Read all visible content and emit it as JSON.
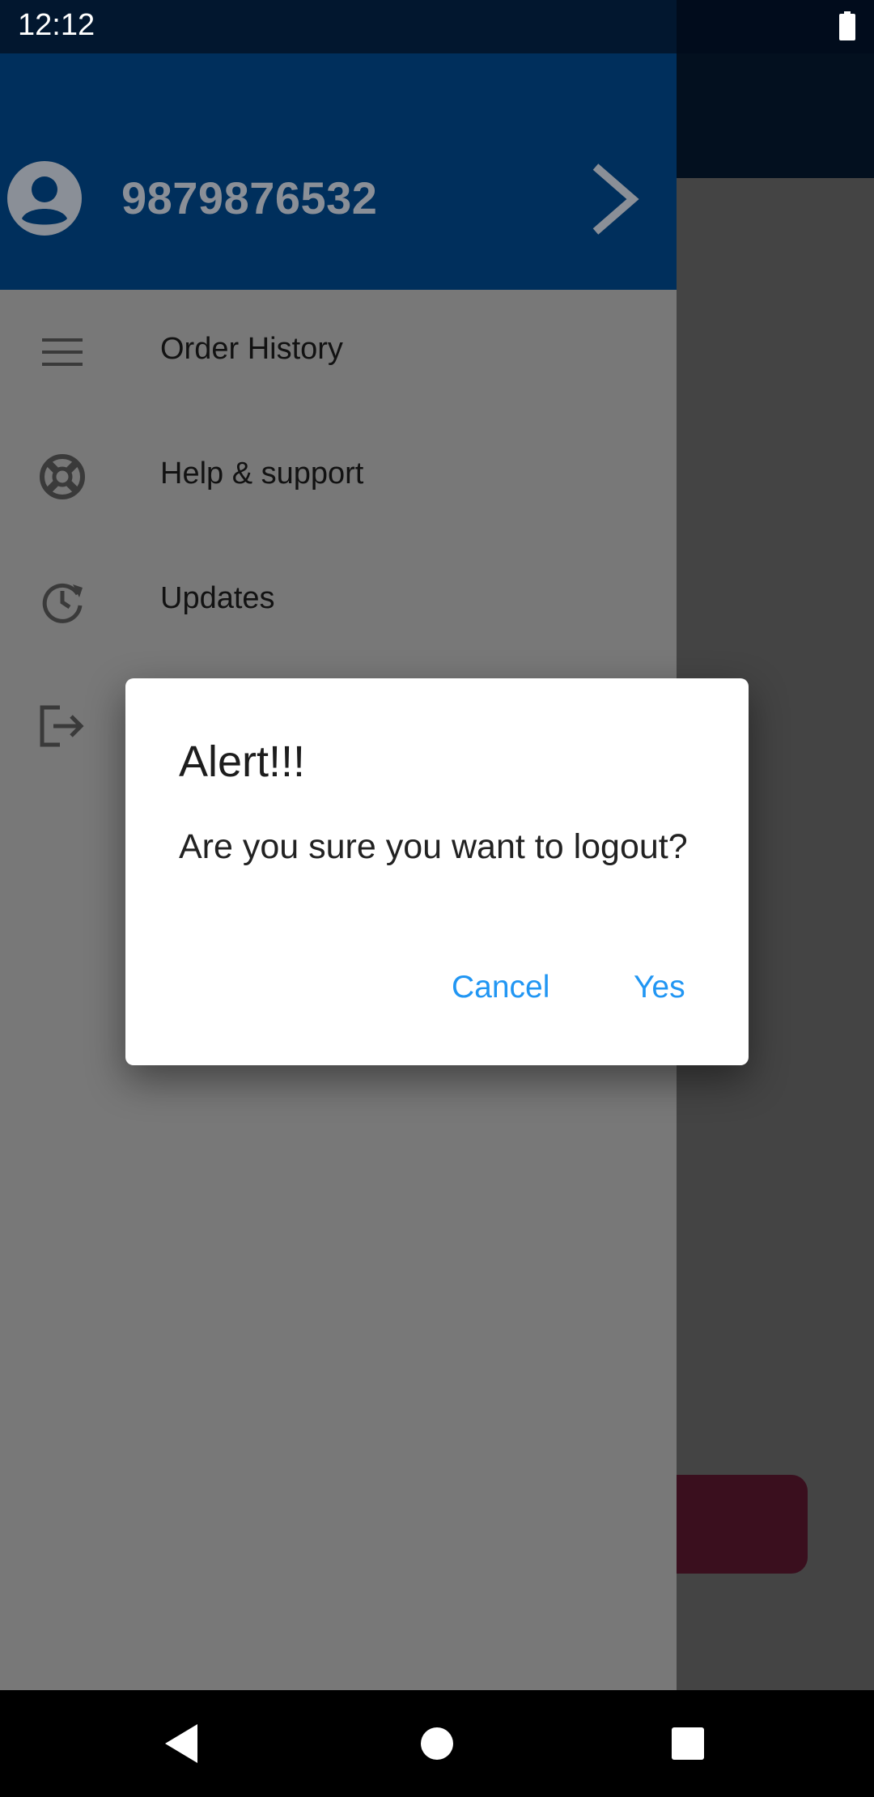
{
  "status_bar": {
    "time": "12:12",
    "battery_icon": "battery-full-icon"
  },
  "drawer": {
    "header": {
      "avatar_icon": "account-circle-icon",
      "phone_number": "9879876532",
      "chevron_icon": "chevron-right-icon",
      "background_color": "#002f5c"
    },
    "items": [
      {
        "label": "Order History",
        "icon": "list-icon"
      },
      {
        "label": "Help & support",
        "icon": "lifebuoy-icon"
      },
      {
        "label": "Updates",
        "icon": "refresh-clock-icon"
      },
      {
        "label": "",
        "icon": "logout-icon"
      }
    ]
  },
  "dialog": {
    "title": "Alert!!!",
    "message": "Are you sure you want to logout?",
    "cancel_label": "Cancel",
    "confirm_label": "Yes",
    "accent_color": "#2196f3"
  },
  "nav_bar": {
    "back_icon": "back-triangle-icon",
    "home_icon": "home-circle-icon",
    "recents_icon": "recents-square-icon"
  }
}
